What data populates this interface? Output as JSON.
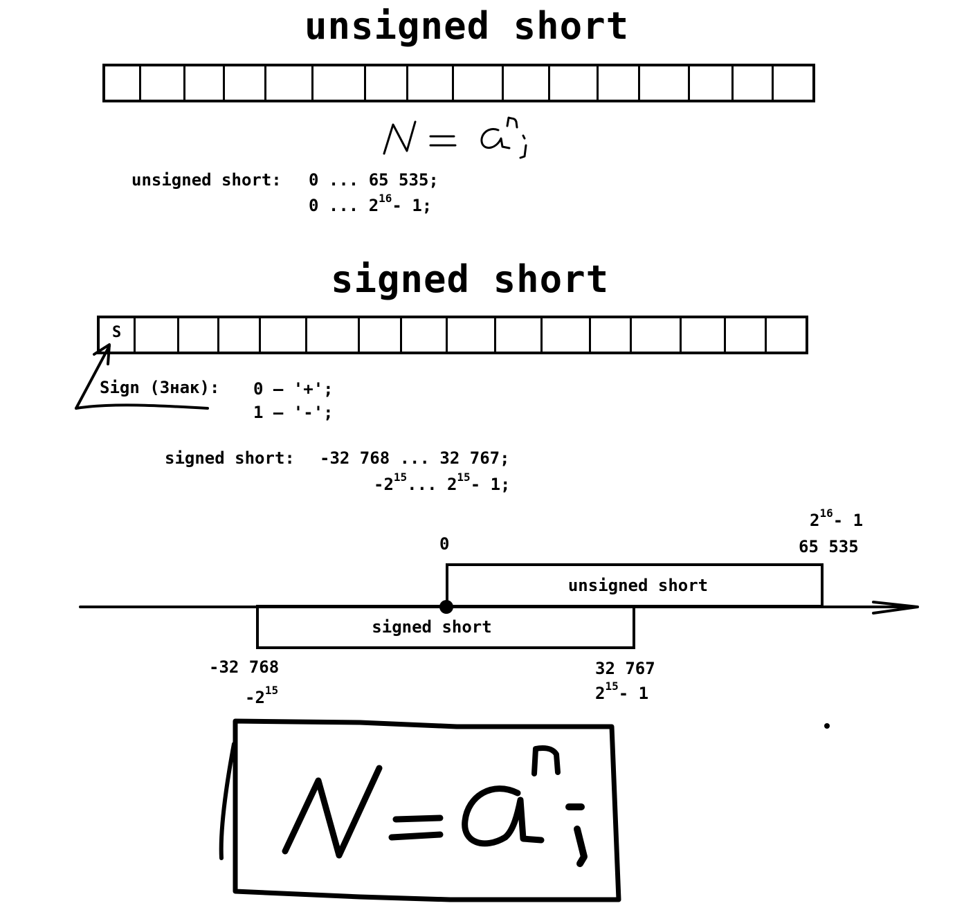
{
  "unsigned_section": {
    "title": "unsigned short",
    "bit_count": 16,
    "range_label": "unsigned short:",
    "range_decimal": "0 ... 65 535;",
    "range_power_prefix": "0 ... 2",
    "range_power_exp": "16",
    "range_power_suffix": "- 1;"
  },
  "formula": {
    "lhs": "N",
    "eq": "=",
    "base": "a",
    "exp": "n",
    "end": ";"
  },
  "signed_section": {
    "title": "signed short",
    "bit_count": 16,
    "sign_bit_label": "S",
    "sign_label": "Sign (Знак):",
    "sign_plus": "0 — '+';",
    "sign_minus": "1 — '-';",
    "range_label": "signed short:",
    "range_decimal": "-32 768 ... 32 767;",
    "range_power_a": "-2",
    "range_power_a_exp": "15",
    "range_power_mid": "... 2",
    "range_power_b_exp": "15",
    "range_power_suffix": "- 1;"
  },
  "number_line": {
    "zero_label": "0",
    "unsigned_max_power_base": "2",
    "unsigned_max_power_exp": "16",
    "unsigned_max_power_suffix": "- 1",
    "unsigned_max_decimal": "65 535",
    "unsigned_box_label": "unsigned short",
    "signed_box_label": "signed short",
    "signed_min_decimal": "-32 768",
    "signed_min_power_base": "-2",
    "signed_min_power_exp": "15",
    "signed_max_decimal": "32 767",
    "signed_max_power_base": "2",
    "signed_max_power_exp": "15",
    "signed_max_power_suffix": "- 1"
  }
}
